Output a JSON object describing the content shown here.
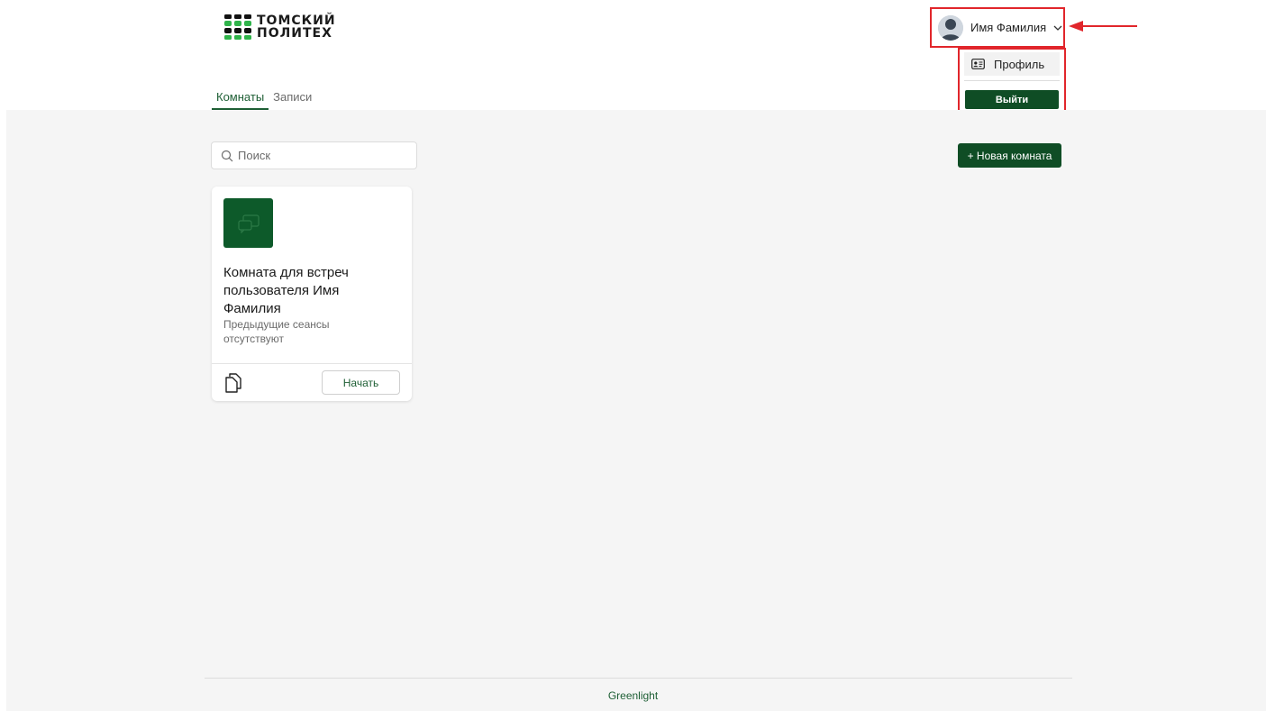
{
  "header": {
    "logo": {
      "line1": "ТОМСКИЙ",
      "line2": "ПОЛИТЕХ"
    },
    "tabs": [
      {
        "label": "Комнаты",
        "active": true
      },
      {
        "label": "Записи",
        "active": false
      }
    ],
    "user": {
      "name": "Имя Фамилия"
    }
  },
  "user_menu": {
    "profile_label": "Профиль",
    "logout_label": "Выйти"
  },
  "toolbar": {
    "search_placeholder": "Поиск",
    "new_room_label": "+ Новая комната"
  },
  "rooms": [
    {
      "title": "Комната для встреч пользователя Имя Фамилия",
      "subtitle": "Предыдущие сеансы отсутствуют",
      "start_label": "Начать"
    }
  ],
  "footer": {
    "text": "Greenlight"
  },
  "colors": {
    "brand_green": "#0f4d25",
    "accent_green": "#1e5f35",
    "highlight_red": "#e1262b",
    "background": "#f5f5f5"
  }
}
